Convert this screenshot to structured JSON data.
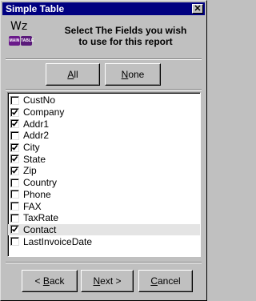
{
  "window": {
    "title": "Simple Table",
    "close_label": "✕"
  },
  "logo": {
    "text": "Wz",
    "badges": [
      "MAIN",
      "TABLE"
    ]
  },
  "header": {
    "line1": "Select The Fields you wish",
    "line2": "to use for this report"
  },
  "buttons": {
    "all": {
      "accel": "A",
      "rest": "ll"
    },
    "none": {
      "accel": "N",
      "rest": "one"
    },
    "back": {
      "prefix": "< ",
      "accel": "B",
      "rest": "ack"
    },
    "next": {
      "accel": "N",
      "rest": "ext >"
    },
    "cancel": {
      "accel": "C",
      "rest": "ancel"
    }
  },
  "fields": [
    {
      "label": "CustNo",
      "checked": false
    },
    {
      "label": "Company",
      "checked": true
    },
    {
      "label": "Addr1",
      "checked": true
    },
    {
      "label": "Addr2",
      "checked": false
    },
    {
      "label": "City",
      "checked": true
    },
    {
      "label": "State",
      "checked": true
    },
    {
      "label": "Zip",
      "checked": true
    },
    {
      "label": "Country",
      "checked": false
    },
    {
      "label": "Phone",
      "checked": false
    },
    {
      "label": "FAX",
      "checked": false
    },
    {
      "label": "TaxRate",
      "checked": false
    },
    {
      "label": "Contact",
      "checked": true,
      "selected": true
    },
    {
      "label": "LastInvoiceDate",
      "checked": false
    }
  ],
  "colors": {
    "titlebar": "#000080",
    "face": "#c0c0c0"
  }
}
